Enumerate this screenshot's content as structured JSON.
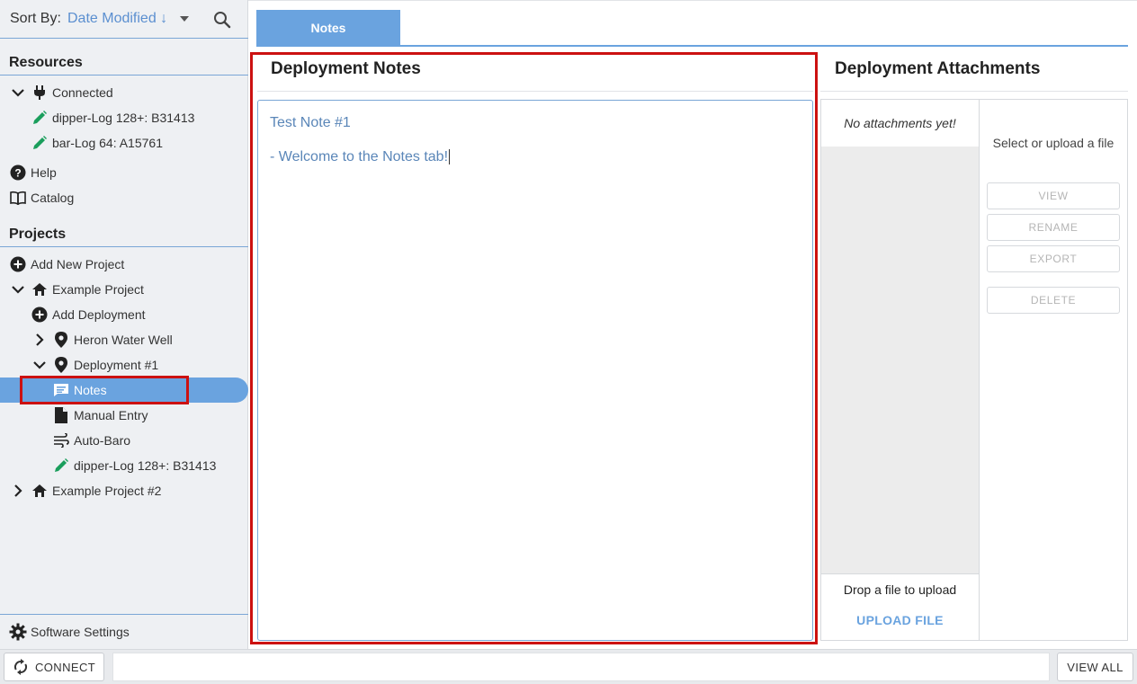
{
  "sortbar": {
    "label": "Sort By:",
    "value": "Date Modified ↓"
  },
  "resources": {
    "title": "Resources",
    "connected": "Connected",
    "devices": [
      "dipper-Log 128+: B31413",
      "bar-Log 64: A15761"
    ],
    "help": "Help",
    "catalog": "Catalog"
  },
  "projects": {
    "title": "Projects",
    "add_project": "Add New Project",
    "example_project": "Example Project",
    "add_deployment": "Add Deployment",
    "heron": "Heron Water Well",
    "deployment": "Deployment #1",
    "notes": "Notes",
    "manual_entry": "Manual Entry",
    "auto_baro": "Auto-Baro",
    "dipper": "dipper-Log 128+: B31413",
    "example_project_2": "Example Project #2"
  },
  "settings": {
    "label": "Software Settings"
  },
  "tabs": {
    "notes": "Notes"
  },
  "notes_panel": {
    "title": "Deployment Notes",
    "lines": [
      "Test Note #1",
      "- Welcome to the Notes tab!"
    ]
  },
  "attachments": {
    "title": "Deployment Attachments",
    "empty": "No attachments yet!",
    "drop": "Drop a file to upload",
    "upload": "UPLOAD FILE",
    "hint": "Select or upload a file",
    "view": "VIEW",
    "rename": "RENAME",
    "export": "EXPORT",
    "delete": "DELETE"
  },
  "bottombar": {
    "connect": "CONNECT",
    "view_all": "VIEW ALL"
  },
  "colors": {
    "accent": "#6aa3df",
    "highlight_red": "#cc1111",
    "edit_green": "#1a9e5c"
  }
}
